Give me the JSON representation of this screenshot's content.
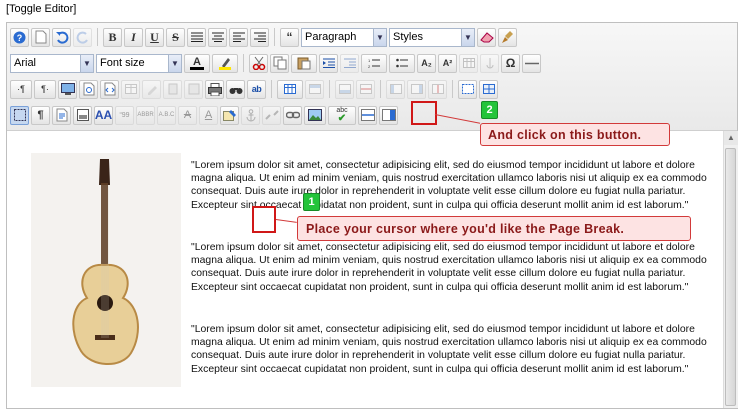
{
  "toggle_editor": "[Toggle Editor]",
  "toolbar": {
    "row1": {
      "bold": "B",
      "italic": "I",
      "underline": "U",
      "strike": "S",
      "quote_icon": "quote-icon",
      "format_value": "Paragraph",
      "styles_value": "Styles"
    },
    "row2": {
      "font_family_value": "Arial",
      "font_size_value": "Font size",
      "subscript": "A₂",
      "superscript": "A²",
      "omega": "Ω"
    },
    "row4": {
      "pilcrow": "¶",
      "spellcheck_label": "abc"
    }
  },
  "content": {
    "paragraphs": [
      "\"Lorem ipsum dolor sit amet, consectetur adipisicing elit, sed do eiusmod tempor incididunt ut labore et dolore magna aliqua. Ut enim ad minim veniam, quis nostrud exercitation ullamco laboris nisi ut aliquip ex ea commodo consequat. Duis aute irure dolor in reprehenderit in voluptate velit esse cillum dolore eu fugiat nulla pariatur. Excepteur sint occaecat cupidatat non proident, sunt in culpa qui officia deserunt mollit anim id est laborum.\"",
      "\"Lorem ipsum dolor sit amet, consectetur adipisicing elit, sed do eiusmod tempor incididunt ut labore et dolore magna aliqua. Ut enim ad minim veniam, quis nostrud exercitation ullamco laboris nisi ut aliquip ex ea commodo consequat. Duis aute irure dolor in reprehenderit in voluptate velit esse cillum dolore eu fugiat nulla pariatur. Excepteur sint occaecat cupidatat non proident, sunt in culpa qui officia deserunt mollit anim id est laborum.\"",
      "\"Lorem ipsum dolor sit amet, consectetur adipisicing elit, sed do eiusmod tempor incididunt ut labore et dolore magna aliqua. Ut enim ad minim veniam, quis nostrud exercitation ullamco laboris nisi ut aliquip ex ea commodo consequat. Duis aute irure dolor in reprehenderit in voluptate velit esse cillum dolore eu fugiat nulla pariatur. Excepteur sint occaecat cupidatat non proident, sunt in culpa qui officia deserunt mollit anim id est laborum.\""
    ]
  },
  "annotations": {
    "step1_badge": "1",
    "step1_text": "Place your cursor where you'd like the Page Break.",
    "step2_badge": "2",
    "step2_text": "And click on this button."
  },
  "colors": {
    "callout_bg": "#fde3e3",
    "callout_border": "#d23a3a",
    "badge_green": "#23c43a"
  }
}
